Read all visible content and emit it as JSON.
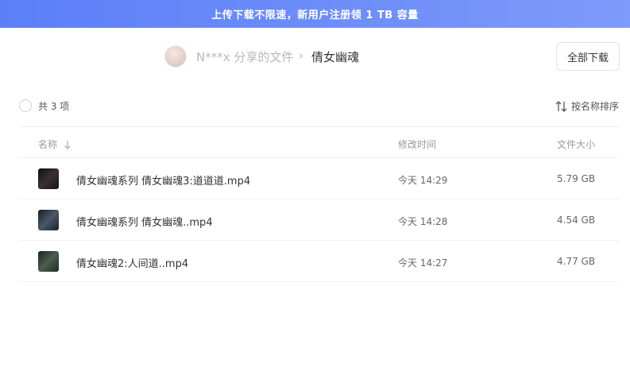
{
  "banner": {
    "text": "上传下载不限速，新用户注册领 1 TB 容量"
  },
  "header": {
    "owner": "N***x 分享的文件",
    "separator": "›",
    "current_folder": "倩女幽魂",
    "download_all_label": "全部下载"
  },
  "toolbar": {
    "count_text": "共 3 项",
    "sort_label": "按名称排序"
  },
  "table": {
    "columns": {
      "name": "名称",
      "modified": "修改时间",
      "size": "文件大小"
    },
    "rows": [
      {
        "name": "倩女幽魂系列 倩女幽魂3:道道道.mp4",
        "modified": "今天 14:29",
        "size": "5.79 GB",
        "thumb_color": "#1c1a1e"
      },
      {
        "name": "倩女幽魂系列 倩女幽魂..mp4",
        "modified": "今天 14:28",
        "size": "4.54 GB",
        "thumb_color": "#263039"
      },
      {
        "name": "倩女幽魂2:人间道..mp4",
        "modified": "今天 14:27",
        "size": "4.77 GB",
        "thumb_color": "#2b3a2f"
      }
    ]
  },
  "colors": {
    "banner_start": "#5b7ff7",
    "banner_end": "#7e9bfb"
  }
}
